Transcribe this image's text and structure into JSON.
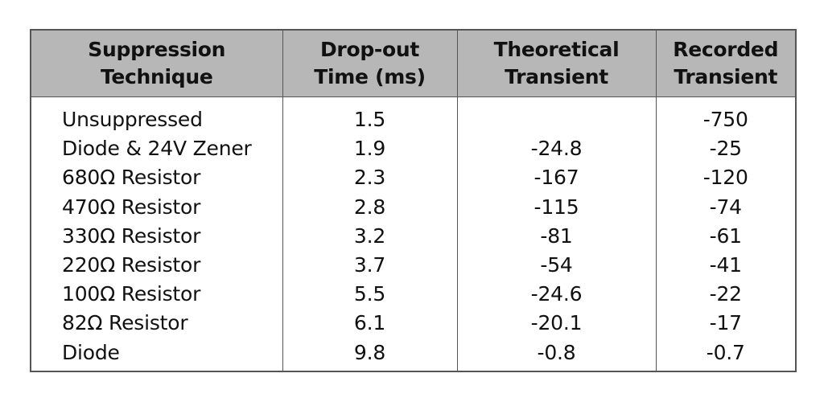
{
  "table": {
    "headers": [
      [
        "Suppression",
        "Technique"
      ],
      [
        "Drop-out",
        "Time (ms)"
      ],
      [
        "Theoretical",
        "Transient"
      ],
      [
        "Recorded",
        "Transient"
      ]
    ],
    "rows": [
      [
        "Unsuppressed",
        "1.5",
        "",
        "-750"
      ],
      [
        "Diode & 24V Zener",
        "1.9",
        "-24.8",
        "-25"
      ],
      [
        "680Ω Resistor",
        "2.3",
        "-167",
        "-120"
      ],
      [
        "470Ω Resistor",
        "2.8",
        "-115",
        "-74"
      ],
      [
        "330Ω Resistor",
        "3.2",
        "-81",
        "-61"
      ],
      [
        "220Ω Resistor",
        "3.7",
        "-54",
        "-41"
      ],
      [
        "100Ω Resistor",
        "5.5",
        "-24.6",
        "-22"
      ],
      [
        "82Ω Resistor",
        "6.1",
        "-20.1",
        "-17"
      ],
      [
        "Diode",
        "9.8",
        "-0.8",
        "-0.7"
      ]
    ]
  },
  "colors": {
    "header_background": "#b7b7b7",
    "border": "#555555",
    "text": "#111111"
  }
}
